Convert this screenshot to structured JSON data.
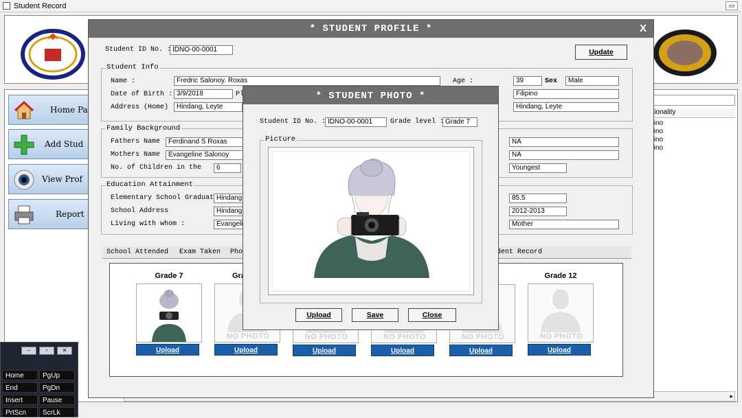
{
  "app": {
    "title": "Student Record"
  },
  "nav": [
    {
      "label": "Home Pa",
      "icon": "home-icon"
    },
    {
      "label": "Add Stud",
      "icon": "plus-icon"
    },
    {
      "label": "View Prof",
      "icon": "eye-icon"
    },
    {
      "label": "Report",
      "icon": "printer-icon"
    }
  ],
  "grid": {
    "header": "ationality",
    "rows": [
      "ipino",
      "ipino",
      "ipino",
      "ipino"
    ]
  },
  "profile": {
    "title": "* STUDENT PROFILE *",
    "close": "X",
    "student_id_label": "Student ID No. :",
    "student_id": "IDNO-00-0001",
    "update_button": "Update",
    "info": {
      "title": "Student Info",
      "name_label": "Name :",
      "name": "Fredric Salonoy. Roxas",
      "age_label": "Age :",
      "age": "39",
      "sex_label": "Sex",
      "sex": "Male",
      "dob_label": "Date of Birth :",
      "dob": "3/9/2018",
      "pl_label": "Pl",
      "nationality": "Filipino",
      "address_label": "Address (Home) :",
      "address": "Hindang, Leyte",
      "address2": "Hindang, Leyte"
    },
    "family": {
      "title": "Family Background",
      "father_label": "Fathers Name",
      "father": "Ferdinand S Roxas",
      "father_occ": "NA",
      "mother_label": "Mothers Name :",
      "mother": "Evangeline Salonoy",
      "mother_occ": "NA",
      "children_label": "No. of Children in the",
      "children": "6",
      "birth_order": "Youngest"
    },
    "education": {
      "title": "Education Attainment",
      "elem_label": "Elementary School Graduated",
      "elem": "Hindang",
      "elem_grade": "85.5",
      "school_address_label": "School Address",
      "school_address": "Hindang",
      "school_year": "2012-2013",
      "living_label": "Living with whom :",
      "living": "Evangelin",
      "guardian": "Mother"
    },
    "tabs": [
      "School Attended",
      "Exam Taken",
      "Pho",
      "dent Record"
    ],
    "grades": [
      {
        "label": "Grade 7",
        "has_photo": true,
        "upload": "Upload"
      },
      {
        "label": "Gra",
        "has_photo": false,
        "upload": "Upload"
      },
      {
        "label": "",
        "has_photo": false,
        "upload": "Upload"
      },
      {
        "label": "",
        "has_photo": false,
        "upload": "Upload"
      },
      {
        "label": "",
        "has_photo": false,
        "upload": "Upload"
      },
      {
        "label": "Grade 12",
        "has_photo": false,
        "upload": "Upload"
      }
    ],
    "no_photo_text": "NO PHOTO"
  },
  "photo_dialog": {
    "title": "* STUDENT PHOTO *",
    "student_id_label": "Student ID No. :",
    "student_id": "IDNO-00-0001",
    "grade_level_label": "Grade level :",
    "grade_level": "Grade 7",
    "picture_label": "Picture",
    "upload_button": "Upload",
    "save_button": "Save",
    "close_button": "Close"
  },
  "keyboard": {
    "keys": [
      [
        "Home",
        "PgUp"
      ],
      [
        "End",
        "PgDn"
      ],
      [
        "Insert",
        "Pause"
      ],
      [
        "PrtScn",
        "ScrLk"
      ]
    ]
  }
}
